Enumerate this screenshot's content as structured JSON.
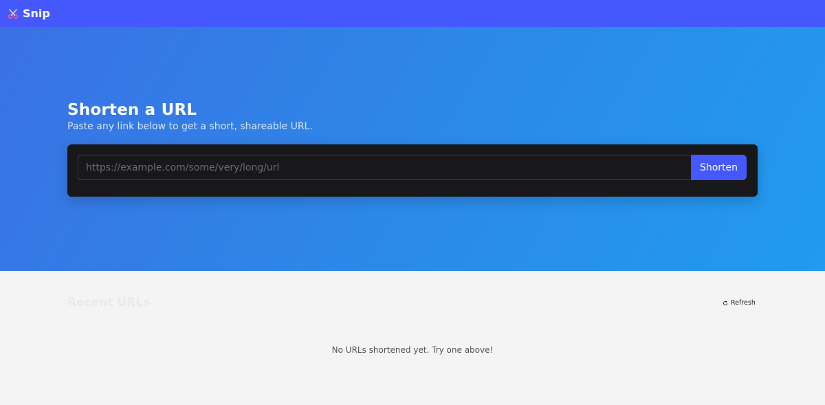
{
  "header": {
    "brand_name": "Snip",
    "brand_icon": "scissors-icon",
    "brand_color": "#4458fe"
  },
  "hero": {
    "title": "Shorten a URL",
    "subtitle": "Paste any link below to get a short, shareable URL."
  },
  "form": {
    "url_value": "",
    "url_placeholder": "https://example.com/some/very/long/url",
    "shorten_label": "Shorten"
  },
  "recent": {
    "title": "Recent URLs",
    "refresh_label": "Refresh",
    "refresh_icon": "refresh-icon",
    "empty_message": "No URLs shortened yet. Try one above!"
  }
}
